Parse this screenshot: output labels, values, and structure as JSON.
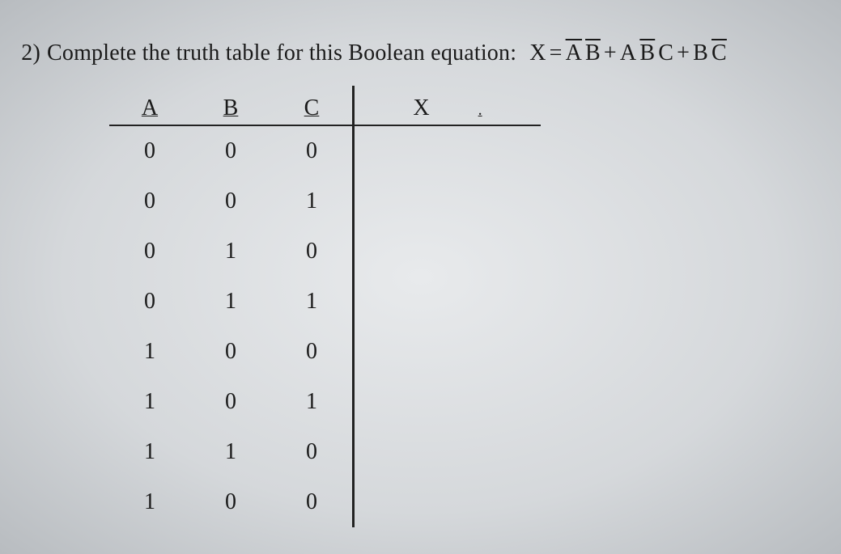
{
  "question": {
    "number": "2)",
    "prompt": "Complete the truth table for  this Boolean equation:",
    "formula": {
      "lhs": "X",
      "eq": "=",
      "terms": [
        {
          "parts": [
            {
              "t": "A",
              "bar": true
            },
            {
              "t": " ",
              "bar": false
            },
            {
              "t": "B",
              "bar": true
            }
          ]
        },
        {
          "parts": [
            {
              "t": "A",
              "bar": false
            },
            {
              "t": " ",
              "bar": false
            },
            {
              "t": "B",
              "bar": true
            },
            {
              "t": " ",
              "bar": false
            },
            {
              "t": "C",
              "bar": false
            }
          ]
        },
        {
          "parts": [
            {
              "t": "B",
              "bar": false
            },
            {
              "t": " ",
              "bar": false
            },
            {
              "t": "C",
              "bar": true
            }
          ]
        }
      ],
      "plus": "+"
    }
  },
  "table": {
    "headers": {
      "a": "A",
      "b": "B",
      "c": "C",
      "x": "X"
    },
    "trailing_dot": ".",
    "rows": [
      {
        "a": "0",
        "b": "0",
        "c": "0",
        "x": ""
      },
      {
        "a": "0",
        "b": "0",
        "c": "1",
        "x": ""
      },
      {
        "a": "0",
        "b": "1",
        "c": "0",
        "x": ""
      },
      {
        "a": "0",
        "b": "1",
        "c": "1",
        "x": ""
      },
      {
        "a": "1",
        "b": "0",
        "c": "0",
        "x": ""
      },
      {
        "a": "1",
        "b": "0",
        "c": "1",
        "x": ""
      },
      {
        "a": "1",
        "b": "1",
        "c": "0",
        "x": ""
      },
      {
        "a": "1",
        "b": "0",
        "c": "0",
        "x": ""
      }
    ]
  },
  "chart_data": {
    "type": "table",
    "title": "Truth table for X = A'B' + AB'C + BC'",
    "columns": [
      "A",
      "B",
      "C",
      "X"
    ],
    "rows": [
      [
        0,
        0,
        0,
        null
      ],
      [
        0,
        0,
        1,
        null
      ],
      [
        0,
        1,
        0,
        null
      ],
      [
        0,
        1,
        1,
        null
      ],
      [
        1,
        0,
        0,
        null
      ],
      [
        1,
        0,
        1,
        null
      ],
      [
        1,
        1,
        0,
        null
      ],
      [
        1,
        0,
        0,
        null
      ]
    ]
  }
}
